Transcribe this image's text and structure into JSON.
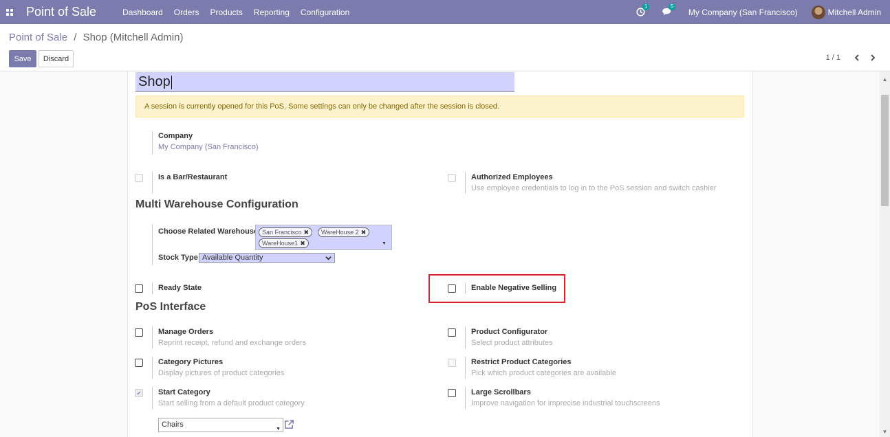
{
  "navbar": {
    "app_title": "Point of Sale",
    "menu": [
      "Dashboard",
      "Orders",
      "Products",
      "Reporting",
      "Configuration"
    ],
    "activity_count": "1",
    "messages_count": "5",
    "company": "My Company (San Francisco)",
    "user": "Mitchell Admin",
    "bg_color": "#7c7bad"
  },
  "breadcrumb": {
    "parent": "Point of Sale",
    "separator": "/",
    "current": "Shop (Mitchell Admin)"
  },
  "buttons": {
    "save": "Save",
    "discard": "Discard"
  },
  "pager": {
    "value": "1 / 1"
  },
  "form": {
    "name": "Shop",
    "alert": "A session is currently opened for this PoS. Some settings can only be changed after the session is closed.",
    "company_label": "Company",
    "company_value": "My Company (San Francisco)",
    "bar_label": "Is a Bar/Restaurant",
    "authorized_label": "Authorized Employees",
    "authorized_desc": "Use employee credentials to log in to the PoS session and switch cashier",
    "multi_wh_title": "Multi Warehouse Configuration",
    "warehouse_label": "Choose Related Warehouse",
    "warehouse_tags": [
      "San Francisco",
      "WareHouse 2",
      "WareHouse1"
    ],
    "stock_type_label": "Stock Type",
    "stock_type_value": "Available Quantity",
    "ready_state_label": "Ready State",
    "negative_selling_label": "Enable Negative Selling",
    "pos_interface_title": "PoS Interface",
    "manage_orders_label": "Manage Orders",
    "manage_orders_desc": "Reprint receipt, refund and exchange orders",
    "product_config_label": "Product Configurator",
    "product_config_desc": "Select product attributes",
    "category_pictures_label": "Category Pictures",
    "category_pictures_desc": "Display pictures of product categories",
    "restrict_categories_label": "Restrict Product Categories",
    "restrict_categories_desc": "Pick which product categories are available",
    "start_category_label": "Start Category",
    "start_category_desc": "Start selling from a default product category",
    "large_scrollbars_label": "Large Scrollbars",
    "large_scrollbars_desc": "Improve navigation for imprecise industrial touchscreens",
    "start_category_value": "Chairs"
  },
  "icons": [
    "apps-grid-icon",
    "activity-clock-icon",
    "chat-bubble-icon",
    "chevron-left-icon",
    "chevron-right-icon",
    "remove-tag-icon",
    "caret-down-icon",
    "external-link-icon",
    "check-icon"
  ],
  "colors": {
    "accent": "#7c7bad",
    "highlight_border": "#d9262d",
    "alert_bg": "#fcf3cd",
    "input_bg": "#d2d2ff"
  }
}
